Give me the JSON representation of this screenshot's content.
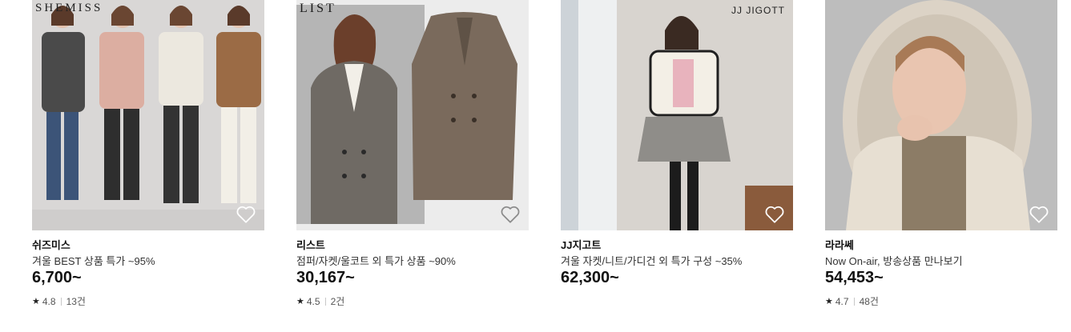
{
  "products": [
    {
      "watermark": "SHEMISS",
      "brand": "쉬즈미스",
      "description": "겨울 BEST 상품 특가 ~95%",
      "price": "6,700~",
      "rating": "4.8",
      "reviews": "13건"
    },
    {
      "watermark": "LIST",
      "brand": "리스트",
      "description": "점퍼/자켓/울코트 외 특가 상품 ~90%",
      "price": "30,167~",
      "rating": "4.5",
      "reviews": "2건"
    },
    {
      "watermark": "JJ JIGOTT",
      "brand": "JJ지고트",
      "description": "겨울 자켓/니트/가디건 외 특가 구성 ~35%",
      "price": "62,300~"
    },
    {
      "brand": "라라쎄",
      "description": "Now On-air, 방송상품 만나보기",
      "price": "54,453~",
      "rating": "4.7",
      "reviews": "48건"
    }
  ],
  "icons": {
    "heart": "heart-outline-icon",
    "star": "star-icon"
  },
  "colors": {
    "text": "#111111",
    "subtext": "#555555",
    "heart_stroke": "#ffffff"
  }
}
